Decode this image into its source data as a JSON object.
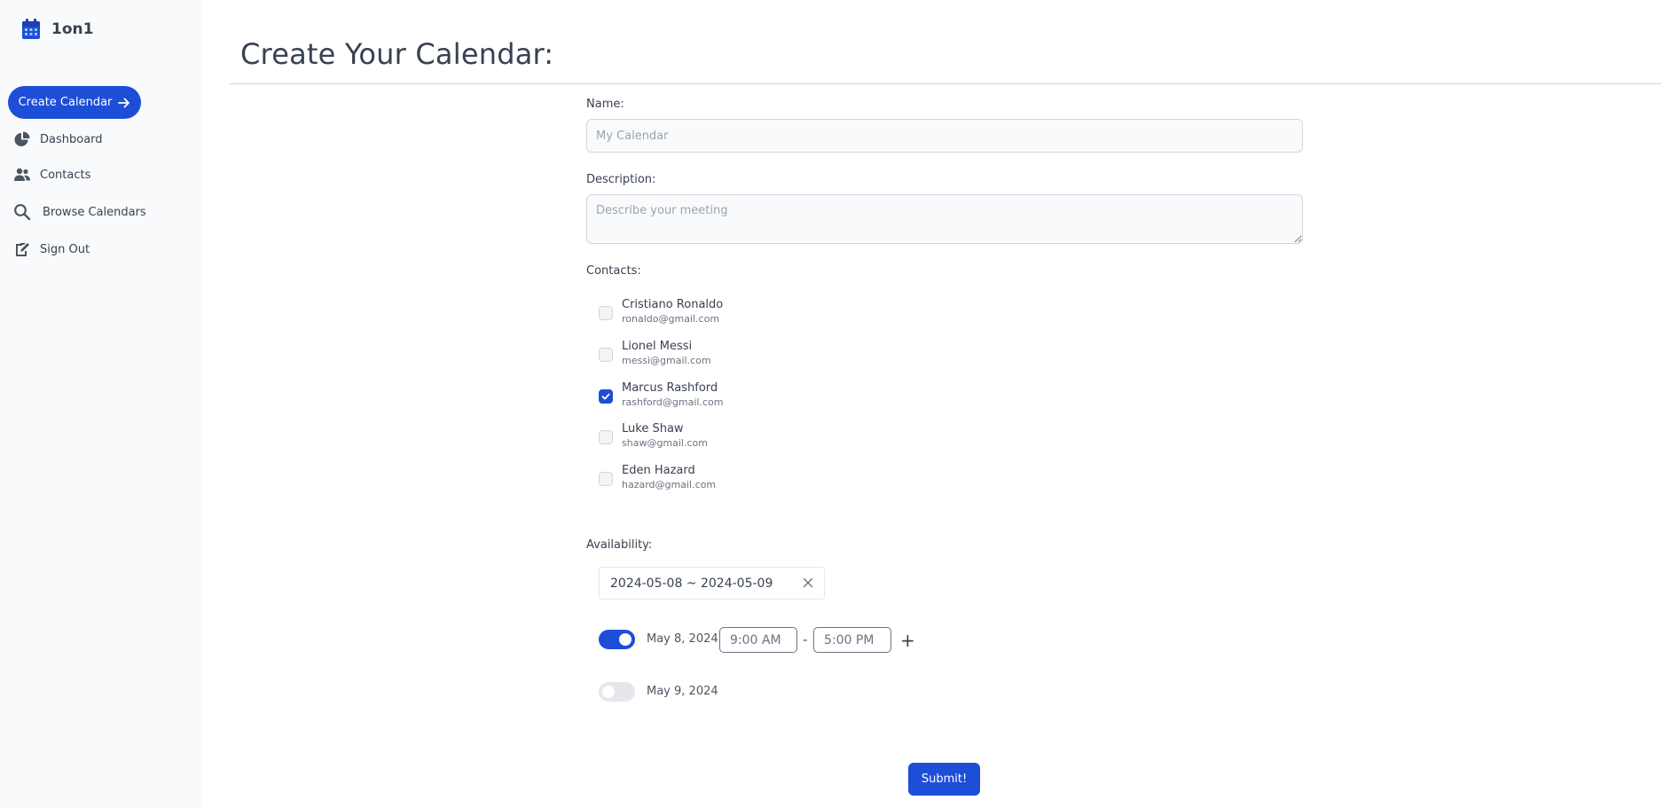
{
  "app": {
    "name": "1on1"
  },
  "sidebar": {
    "create_button": "Create Calendar",
    "items": [
      {
        "label": "Dashboard",
        "icon": "pie-chart-icon"
      },
      {
        "label": "Contacts",
        "icon": "users-icon"
      },
      {
        "label": "Browse Calendars",
        "icon": "search-icon"
      },
      {
        "label": "Sign Out",
        "icon": "sign-out-icon"
      }
    ]
  },
  "page": {
    "title": "Create Your Calendar:"
  },
  "form": {
    "name_label": "Name:",
    "name_placeholder": "My Calendar",
    "description_label": "Description:",
    "description_placeholder": "Describe your meeting",
    "contacts_label": "Contacts:",
    "contacts": [
      {
        "name": "Cristiano Ronaldo",
        "email": "ronaldo@gmail.com",
        "checked": false
      },
      {
        "name": "Lionel Messi",
        "email": "messi@gmail.com",
        "checked": false
      },
      {
        "name": "Marcus Rashford",
        "email": "rashford@gmail.com",
        "checked": true
      },
      {
        "name": "Luke Shaw",
        "email": "shaw@gmail.com",
        "checked": false
      },
      {
        "name": "Eden Hazard",
        "email": "hazard@gmail.com",
        "checked": false
      }
    ],
    "availability_label": "Availability:",
    "date_range": "2024-05-08 ~ 2024-05-09",
    "days": [
      {
        "date": "May 8, 2024",
        "enabled": true,
        "start": "9:00 AM",
        "end": "5:00 PM",
        "separator": "-",
        "add": "+"
      },
      {
        "date": "May 9, 2024",
        "enabled": false
      }
    ],
    "submit_label": "Submit!"
  },
  "colors": {
    "accent": "#1d4ed8",
    "sidebar_bg": "#f9fafb",
    "text": "#374151"
  }
}
